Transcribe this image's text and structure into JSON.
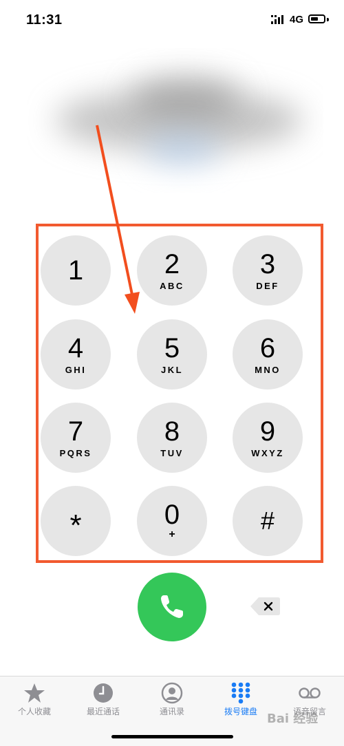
{
  "status_bar": {
    "time": "11:31",
    "network": "4G",
    "icons": [
      "signal-icon",
      "battery-icon"
    ]
  },
  "keypad": {
    "keys": [
      {
        "digit": "1",
        "letters": ""
      },
      {
        "digit": "2",
        "letters": "ABC"
      },
      {
        "digit": "3",
        "letters": "DEF"
      },
      {
        "digit": "4",
        "letters": "GHI"
      },
      {
        "digit": "5",
        "letters": "JKL"
      },
      {
        "digit": "6",
        "letters": "MNO"
      },
      {
        "digit": "7",
        "letters": "PQRS"
      },
      {
        "digit": "8",
        "letters": "TUV"
      },
      {
        "digit": "9",
        "letters": "WXYZ"
      },
      {
        "digit": "*",
        "letters": ""
      },
      {
        "digit": "0",
        "letters": "+"
      },
      {
        "digit": "#",
        "letters": ""
      }
    ]
  },
  "call_button": {
    "icon": "phone-icon",
    "color": "#34c759"
  },
  "delete_button": {
    "icon": "delete-icon"
  },
  "annotation": {
    "box_color": "#f25a2f",
    "arrow_color": "#f24e1e"
  },
  "tab_bar": {
    "tabs": [
      {
        "label": "个人收藏",
        "icon": "star-icon"
      },
      {
        "label": "最近通话",
        "icon": "clock-icon"
      },
      {
        "label": "通讯录",
        "icon": "contacts-icon"
      },
      {
        "label": "拨号键盘",
        "icon": "keypad-icon",
        "active": true
      },
      {
        "label": "语音留言",
        "icon": "voicemail-icon"
      }
    ],
    "active_color": "#1a7cf5"
  },
  "watermark": "Bai 经验"
}
